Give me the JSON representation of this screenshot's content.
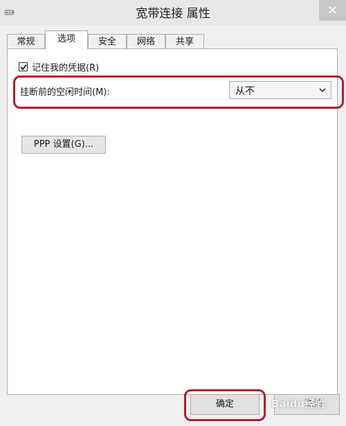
{
  "window": {
    "title": "宽带连接 属性"
  },
  "tabs": [
    {
      "label": "常规",
      "active": false
    },
    {
      "label": "选项",
      "active": true
    },
    {
      "label": "安全",
      "active": false
    },
    {
      "label": "网络",
      "active": false
    },
    {
      "label": "共享",
      "active": false
    }
  ],
  "options": {
    "remember_credentials": {
      "label": "记住我的凭据(R)",
      "checked": true
    },
    "idle_time": {
      "label": "挂断前的空闲时间(M):",
      "value": "从不"
    },
    "ppp_button": "PPP 设置(G)..."
  },
  "buttons": {
    "ok": "确定",
    "cancel": "取消"
  },
  "watermark": "Baidu经验",
  "colors": {
    "highlight": "#b21d2c",
    "titlebar": "#e7e7e7",
    "dialog_bg": "#f0f0f0"
  }
}
